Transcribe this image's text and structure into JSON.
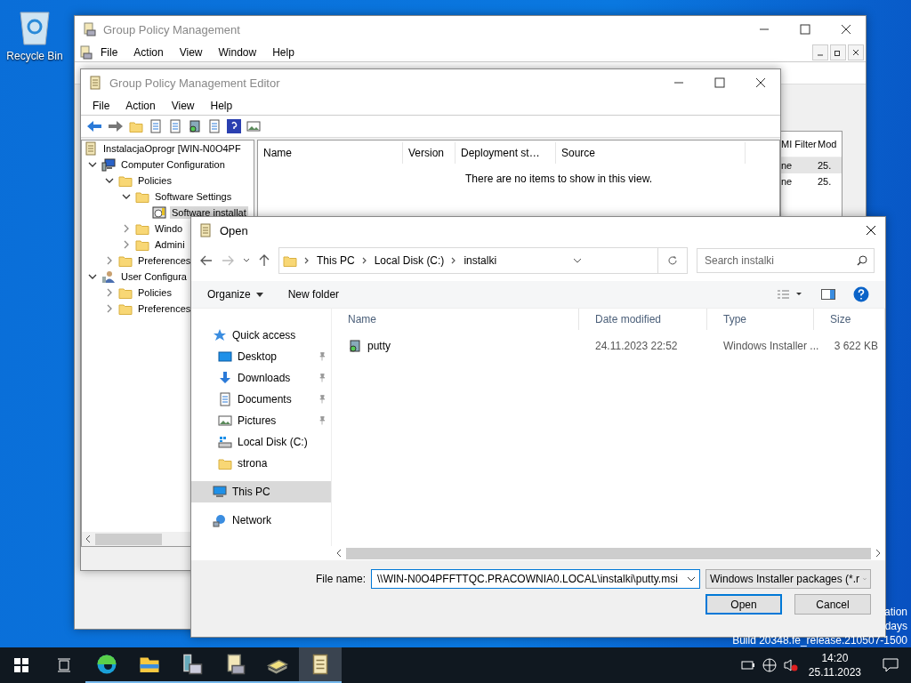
{
  "desktop": {
    "icons": [
      {
        "label": "Recycle Bin"
      }
    ],
    "watermark_lines": [
      "ation",
      "days",
      "Build 20348.fe_release.210507-1500"
    ]
  },
  "gpm_window": {
    "title": "Group Policy Management",
    "menu": [
      "File",
      "Action",
      "View",
      "Window",
      "Help"
    ],
    "list": {
      "columns": [
        "MI Filter",
        "Mod"
      ],
      "rows": [
        {
          "cells": [
            "ne",
            "25."
          ],
          "selected": true
        },
        {
          "cells": [
            "ne",
            "25."
          ],
          "selected": false
        }
      ]
    }
  },
  "editor_window": {
    "title": "Group Policy Management Editor",
    "menu": [
      "File",
      "Action",
      "View",
      "Help"
    ],
    "tree": [
      {
        "label": "InstalacjaOprogr [WIN-N0O4PF",
        "kind": "scroll",
        "selected": false,
        "children": [
          {
            "label": "Computer Configuration",
            "kind": "computer",
            "expanded": true,
            "selected": false,
            "children": [
              {
                "label": "Policies",
                "kind": "folder",
                "expanded": true,
                "selected": false,
                "children": [
                  {
                    "label": "Software Settings",
                    "kind": "folder",
                    "expanded": true,
                    "selected": false,
                    "children": [
                      {
                        "label": "Software installat",
                        "kind": "installer",
                        "selected": true
                      }
                    ]
                  },
                  {
                    "label": "Windo",
                    "kind": "folder",
                    "expanded": false,
                    "selected": false
                  },
                  {
                    "label": "Admini",
                    "kind": "folder",
                    "expanded": false,
                    "selected": false
                  }
                ]
              },
              {
                "label": "Preferences",
                "kind": "folder",
                "expanded": false,
                "selected": false
              }
            ]
          },
          {
            "label": "User Configura",
            "kind": "user",
            "expanded": true,
            "selected": false,
            "children": [
              {
                "label": "Policies",
                "kind": "folder",
                "expanded": false,
                "selected": false
              },
              {
                "label": "Preferences",
                "kind": "folder",
                "expanded": false,
                "selected": false
              }
            ]
          }
        ]
      }
    ],
    "list": {
      "columns": [
        "Name",
        "Version",
        "Deployment st…",
        "Source"
      ],
      "empty_message": "There are no items to show in this view."
    }
  },
  "open_dialog": {
    "title": "Open",
    "breadcrumb": [
      "This PC",
      "Local Disk (C:)",
      "instalki"
    ],
    "search": {
      "placeholder": "Search instalki"
    },
    "commands": [
      "Organize",
      "New folder"
    ],
    "nav": [
      {
        "label": "Quick access",
        "kind": "star",
        "pinned": false,
        "selected": false
      },
      {
        "label": "Desktop",
        "kind": "desktop",
        "pinned": true,
        "selected": false
      },
      {
        "label": "Downloads",
        "kind": "download",
        "pinned": true,
        "selected": false
      },
      {
        "label": "Documents",
        "kind": "document",
        "pinned": true,
        "selected": false
      },
      {
        "label": "Pictures",
        "kind": "picture",
        "pinned": true,
        "selected": false
      },
      {
        "label": "Local Disk (C:)",
        "kind": "drive",
        "pinned": false,
        "selected": false
      },
      {
        "label": "strona",
        "kind": "folder",
        "pinned": false,
        "selected": false
      },
      {
        "label": "This PC",
        "kind": "pc",
        "pinned": false,
        "selected": true
      },
      {
        "label": "Network",
        "kind": "network",
        "pinned": false,
        "selected": false
      }
    ],
    "columns": [
      "Name",
      "Date modified",
      "Type",
      "Size"
    ],
    "files": [
      {
        "name": "putty",
        "date": "24.11.2023 22:52",
        "type": "Windows Installer ...",
        "size": "3 622 KB",
        "selected": false
      }
    ],
    "file_name_label": "File name:",
    "file_name": "\\\\WIN-N0O4PFFTTQC.PRACOWNIA0.LOCAL\\instalki\\putty.msi",
    "filter": "Windows Installer packages (*.r",
    "buttons": [
      {
        "label": "Open",
        "default": true
      },
      {
        "label": "Cancel",
        "default": false
      }
    ]
  },
  "taskbar": {
    "apps": [
      {
        "kind": "edge",
        "selected": false
      },
      {
        "kind": "explorer",
        "selected": false
      },
      {
        "kind": "server",
        "selected": false
      },
      {
        "kind": "gpm",
        "selected": false
      },
      {
        "kind": "book",
        "selected": false
      },
      {
        "kind": "scroll",
        "selected": true
      }
    ],
    "clock": {
      "time": "14:20",
      "date": "25.11.2023"
    }
  }
}
